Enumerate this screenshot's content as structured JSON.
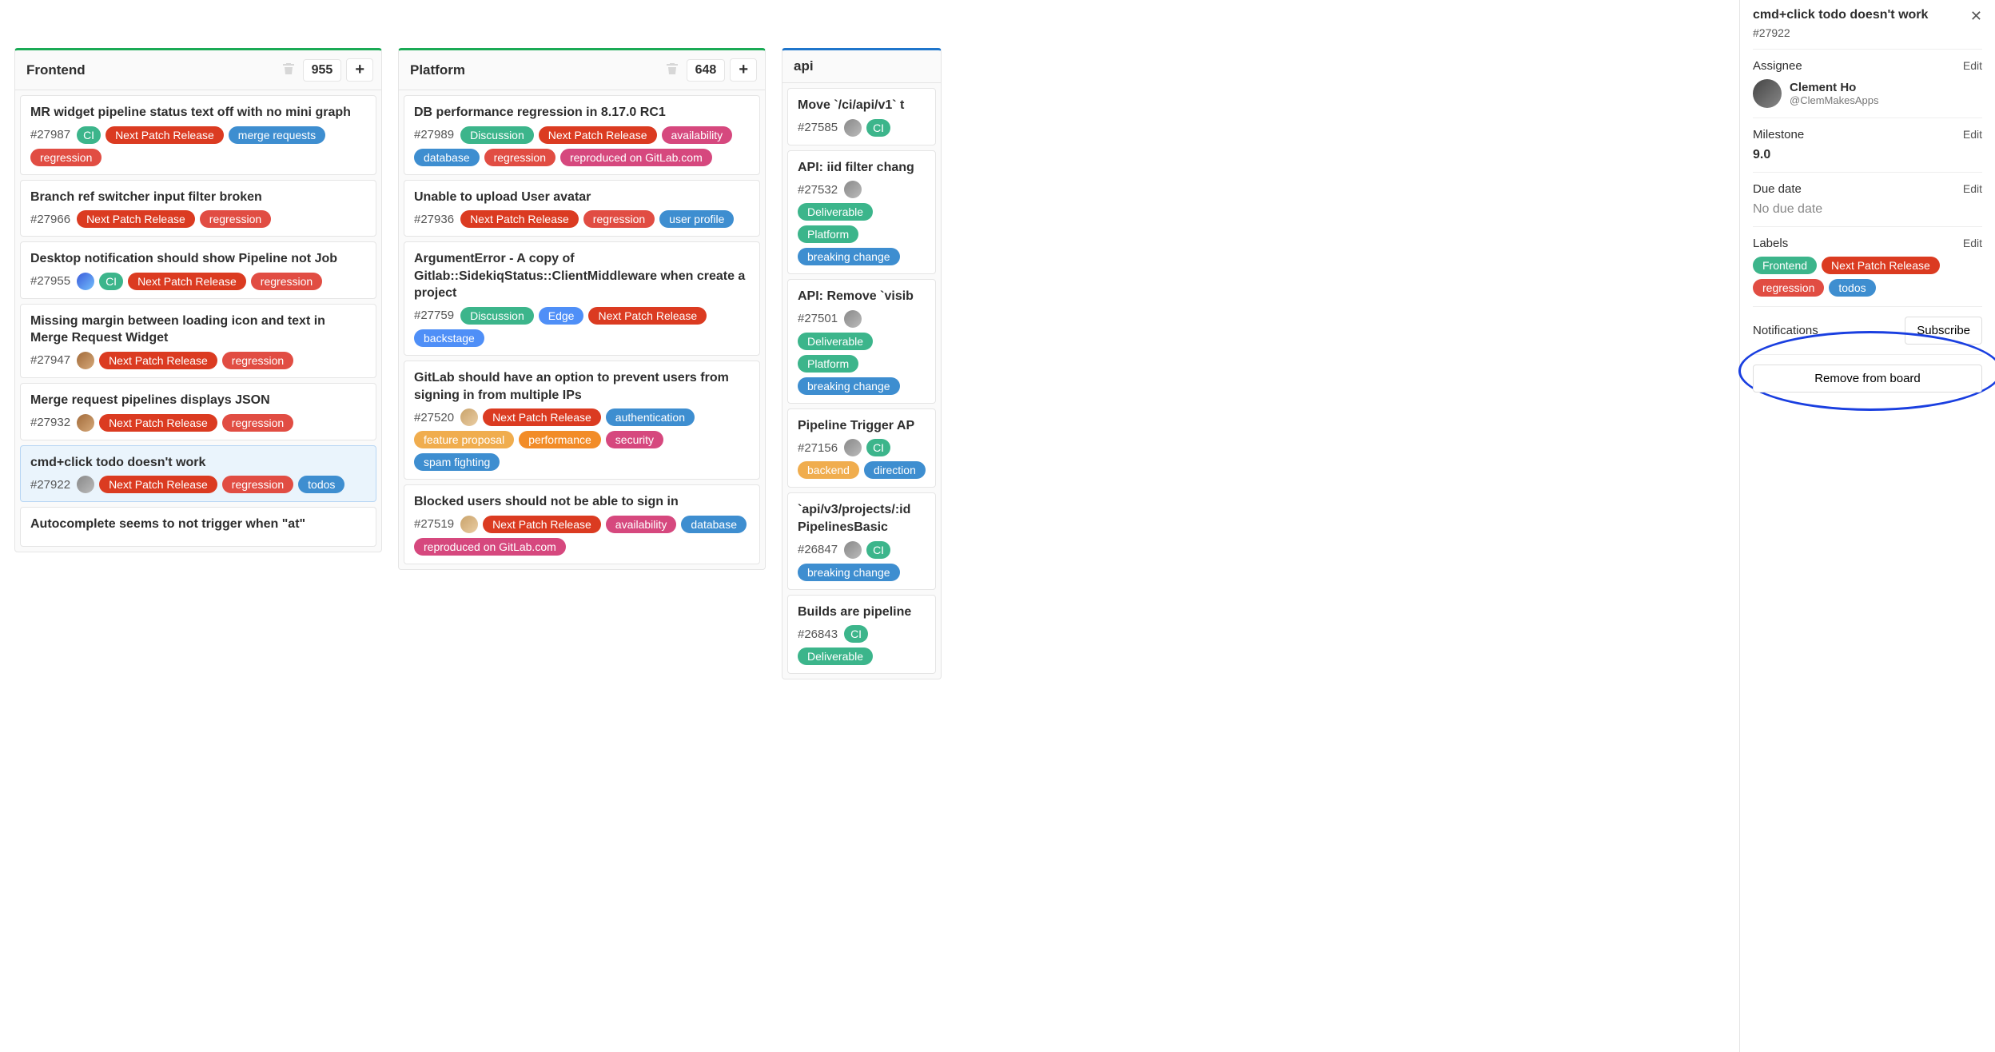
{
  "columns": [
    {
      "key": "frontend",
      "title": "Frontend",
      "count": "955",
      "topColor": "green",
      "cards": [
        {
          "title": "MR widget pipeline status text off with no mini graph",
          "id": "#27987",
          "avatar": null,
          "labels": [
            "CI",
            "Next Patch Release",
            "merge requests",
            "regression"
          ]
        },
        {
          "title": "Branch ref switcher input filter broken",
          "id": "#27966",
          "avatar": null,
          "labels": [
            "Next Patch Release",
            "regression"
          ]
        },
        {
          "title": "Desktop notification should show Pipeline not Job",
          "id": "#27955",
          "avatar": "blue",
          "labels": [
            "CI",
            "Next Patch Release",
            "regression"
          ]
        },
        {
          "title": "Missing margin between loading icon and text in Merge Request Widget",
          "id": "#27947",
          "avatar": "brown",
          "labels": [
            "Next Patch Release",
            "regression"
          ]
        },
        {
          "title": "Merge request pipelines displays JSON",
          "id": "#27932",
          "avatar": "brown",
          "labels": [
            "Next Patch Release",
            "regression"
          ]
        },
        {
          "title": "cmd+click todo doesn't work",
          "id": "#27922",
          "avatar": "gray",
          "selected": true,
          "labels": [
            "Next Patch Release",
            "regression",
            "todos"
          ]
        },
        {
          "title": "Autocomplete seems to not trigger when \"at\"",
          "id": "",
          "avatar": null,
          "labels": []
        }
      ]
    },
    {
      "key": "platform",
      "title": "Platform",
      "count": "648",
      "topColor": "green",
      "cards": [
        {
          "title": "DB performance regression in 8.17.0 RC1",
          "id": "#27989",
          "avatar": null,
          "labels": [
            "Discussion",
            "Next Patch Release",
            "availability",
            "database",
            "regression",
            "reproduced on GitLab.com"
          ]
        },
        {
          "title": "Unable to upload User avatar",
          "id": "#27936",
          "avatar": null,
          "labels": [
            "Next Patch Release",
            "regression",
            "user profile"
          ]
        },
        {
          "title": "ArgumentError - A copy of Gitlab::SidekiqStatus::ClientMiddleware when create a project",
          "id": "#27759",
          "avatar": null,
          "labels": [
            "Discussion",
            "Edge",
            "Next Patch Release",
            "backstage"
          ]
        },
        {
          "title": "GitLab should have an option to prevent users from signing in from multiple IPs",
          "id": "#27520",
          "avatar": "tan",
          "labels": [
            "Next Patch Release",
            "authentication",
            "feature proposal",
            "performance",
            "security",
            "spam fighting"
          ]
        },
        {
          "title": "Blocked users should not be able to sign in",
          "id": "#27519",
          "avatar": "tan",
          "labels": [
            "Next Patch Release",
            "availability",
            "database",
            "reproduced on GitLab.com"
          ]
        }
      ]
    },
    {
      "key": "api",
      "title": "api",
      "count": "",
      "topColor": "blue",
      "cards": [
        {
          "title": "Move `/ci/api/v1` t",
          "id": "#27585",
          "avatar": "gray",
          "labels": [
            "CI"
          ]
        },
        {
          "title": "API: iid filter chang",
          "id": "#27532",
          "avatar": "gray",
          "labels": [
            "Deliverable",
            "Platform",
            "breaking change"
          ]
        },
        {
          "title": "API: Remove `visib",
          "id": "#27501",
          "avatar": "gray",
          "labels": [
            "Deliverable",
            "Platform",
            "breaking change"
          ]
        },
        {
          "title": "Pipeline Trigger AP",
          "id": "#27156",
          "avatar": "gray",
          "labels": [
            "CI",
            "backend",
            "direction"
          ]
        },
        {
          "title": "`api/v3/projects/:id PipelinesBasic",
          "id": "#26847",
          "avatar": "gray",
          "labels": [
            "CI",
            "breaking change"
          ]
        },
        {
          "title": "Builds are pipeline",
          "id": "#26843",
          "avatar": null,
          "labels": [
            "CI",
            "Deliverable"
          ]
        }
      ]
    }
  ],
  "sidebar": {
    "title": "cmd+click todo doesn't work",
    "id": "#27922",
    "assignee_label": "Assignee",
    "assignee_name": "Clement Ho",
    "assignee_handle": "@ClemMakesApps",
    "milestone_label": "Milestone",
    "milestone_value": "9.0",
    "duedate_label": "Due date",
    "duedate_value": "No due date",
    "labels_label": "Labels",
    "labels": [
      "Frontend",
      "Next Patch Release",
      "regression",
      "todos"
    ],
    "notifications_label": "Notifications",
    "subscribe": "Subscribe",
    "remove": "Remove from board",
    "edit": "Edit"
  },
  "label_classes": {
    "CI": "lbl-CI",
    "Next Patch Release": "lbl-NextPatchRelease",
    "merge requests": "lbl-mergerequests",
    "regression": "lbl-regression",
    "Discussion": "lbl-Discussion",
    "availability": "lbl-availability",
    "database": "lbl-database",
    "reproduced on GitLab.com": "lbl-reproducedonGitLabcom",
    "user profile": "lbl-userprofile",
    "Edge": "lbl-Edge",
    "backstage": "lbl-backstage",
    "authentication": "lbl-authentication",
    "feature proposal": "lbl-featureproposal",
    "performance": "lbl-performance",
    "security": "lbl-security",
    "spam fighting": "lbl-spamfighting",
    "todos": "lbl-todos",
    "Platform": "lbl-Platform",
    "breaking change": "lbl-breakingchange",
    "Deliverable": "lbl-Deliverable",
    "backend": "lbl-backend",
    "direction": "lbl-direction",
    "Frontend": "lbl-Frontend"
  }
}
